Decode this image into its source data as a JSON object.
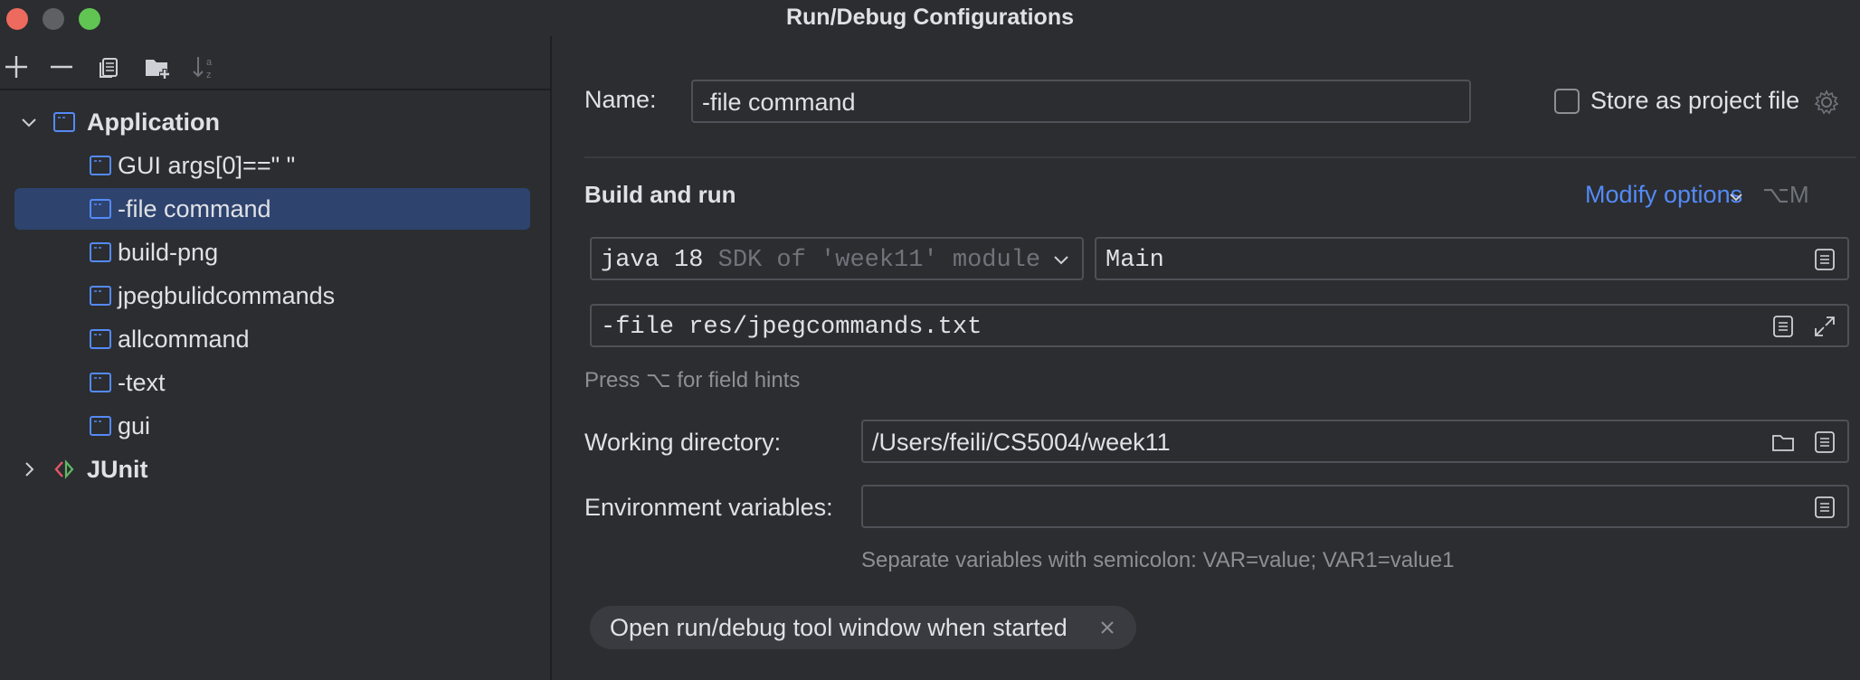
{
  "window": {
    "title": "Run/Debug Configurations"
  },
  "toolbar": {
    "icons": [
      "add-icon",
      "remove-icon",
      "copy-icon",
      "new-folder-icon",
      "sort-icon"
    ]
  },
  "tree": {
    "groups": [
      {
        "label": "Application",
        "expanded": true,
        "children": [
          {
            "label": "GUI args[0]==\" \""
          },
          {
            "label": "-file command",
            "selected": true
          },
          {
            "label": "build-png"
          },
          {
            "label": "jpegbulidcommands"
          },
          {
            "label": "allcommand"
          },
          {
            "label": "-text"
          },
          {
            "label": "gui"
          }
        ]
      },
      {
        "label": "JUnit",
        "expanded": false
      }
    ]
  },
  "form": {
    "name_label": "Name:",
    "name_value": "-file command",
    "store_label": "Store as project file",
    "store_checked": false,
    "section_title": "Build and run",
    "modify_options": "Modify options",
    "modify_shortcut": "⌥M",
    "sdk_name": "java 18",
    "sdk_desc": "SDK of 'week11' module",
    "main_class": "Main",
    "program_args": "-file res/jpegcommands.txt",
    "field_hints": "Press ⌥ for field hints",
    "workdir_label": "Working directory:",
    "workdir_value": "/Users/feili/CS5004/week11",
    "env_label": "Environment variables:",
    "env_value": "",
    "env_hint": "Separate variables with semicolon: VAR=value; VAR1=value1",
    "chip_label": "Open run/debug tool window when started"
  },
  "colors": {
    "background": "#2b2d30",
    "selection": "#2e436e",
    "accent_link": "#548af7",
    "config_icon": "#548af7"
  }
}
